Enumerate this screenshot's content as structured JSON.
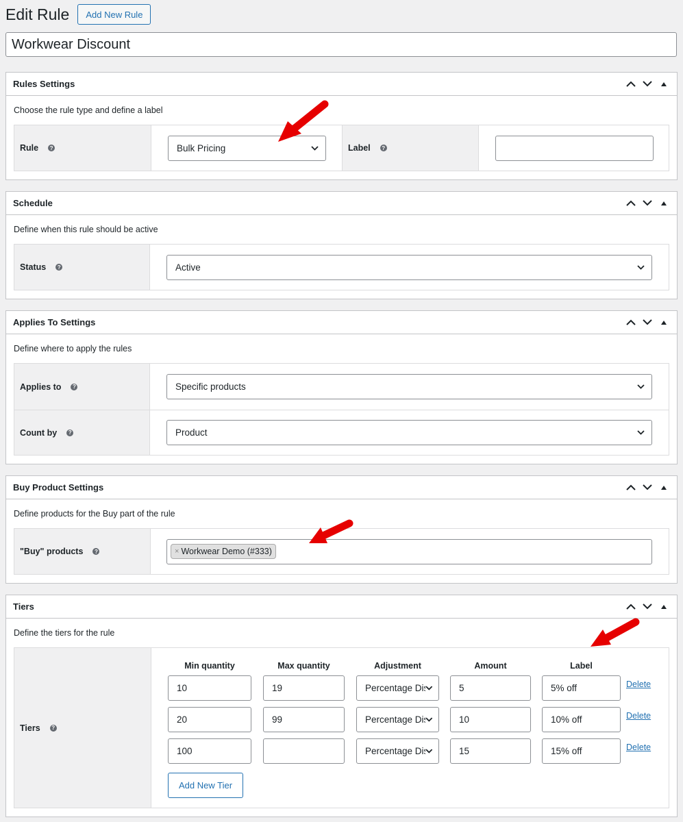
{
  "header": {
    "title": "Edit Rule",
    "add_new_label": "Add New Rule"
  },
  "rule_title": "Workwear Discount",
  "panels": {
    "rules_settings": {
      "title": "Rules Settings",
      "description": "Choose the rule type and define a label",
      "rule_label": "Rule",
      "rule_value": "Bulk Pricing",
      "label_label": "Label",
      "label_value": ""
    },
    "schedule": {
      "title": "Schedule",
      "description": "Define when this rule should be active",
      "status_label": "Status",
      "status_value": "Active"
    },
    "applies_to": {
      "title": "Applies To Settings",
      "description": "Define where to apply the rules",
      "applies_label": "Applies to",
      "applies_value": "Specific products",
      "count_label": "Count by",
      "count_value": "Product"
    },
    "buy_product": {
      "title": "Buy Product Settings",
      "description": "Define products for the Buy part of the rule",
      "products_label": "\"Buy\" products",
      "token": "Workwear Demo (#333)",
      "token_remove": "×"
    },
    "tiers": {
      "title": "Tiers",
      "description": "Define the tiers for the rule",
      "label": "Tiers",
      "columns": [
        "Min quantity",
        "Max quantity",
        "Adjustment",
        "Amount",
        "Label"
      ],
      "rows": [
        {
          "min": "10",
          "max": "19",
          "adjustment": "Percentage Discount",
          "amount": "5",
          "label": "5% off",
          "delete": "Delete"
        },
        {
          "min": "20",
          "max": "99",
          "adjustment": "Percentage Discount",
          "amount": "10",
          "label": "10% off",
          "delete": "Delete"
        },
        {
          "min": "100",
          "max": "",
          "adjustment": "Percentage Discount",
          "amount": "15",
          "label": "15% off",
          "delete": "Delete"
        }
      ],
      "add_tier_label": "Add New Tier"
    }
  },
  "help_glyph": "?",
  "colors": {
    "link": "#2271b1",
    "arrow": "#e60000",
    "label_bg": "#f0f0f1"
  }
}
